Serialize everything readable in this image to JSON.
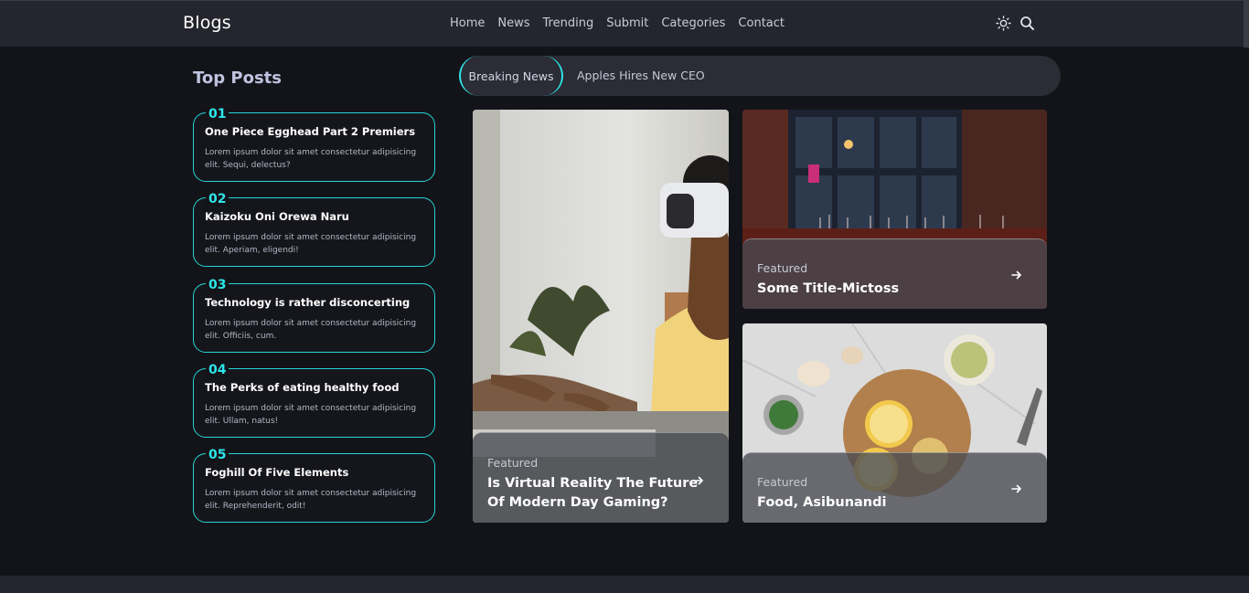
{
  "header": {
    "brand": "Blogs",
    "nav": [
      "Home",
      "News",
      "Trending",
      "Submit",
      "Categories",
      "Contact"
    ],
    "icons": [
      "sun-icon",
      "search-icon"
    ]
  },
  "top_posts": {
    "title": "Top Posts",
    "items": [
      {
        "num": "01",
        "title": "One Piece Egghead Part 2 Premiers",
        "desc": "Lorem ipsum dolor sit amet consectetur adipisicing elit. Sequi, delectus?"
      },
      {
        "num": "02",
        "title": "Kaizoku Oni Orewa Naru",
        "desc": "Lorem ipsum dolor sit amet consectetur adipisicing elit. Aperiam, eligendi!"
      },
      {
        "num": "03",
        "title": "Technology is rather disconcerting",
        "desc": "Lorem ipsum dolor sit amet consectetur adipisicing elit. Officiis, cum."
      },
      {
        "num": "04",
        "title": "The Perks of eating healthy food",
        "desc": "Lorem ipsum dolor sit amet consectetur adipisicing elit. Ullam, natus!"
      },
      {
        "num": "05",
        "title": "Foghill Of Five Elements",
        "desc": "Lorem ipsum dolor sit amet consectetur adipisicing elit. Reprehenderit, odit!"
      }
    ]
  },
  "breaking": {
    "label": "Breaking News",
    "headline": "Apples Hires New CEO"
  },
  "featured": [
    {
      "kicker": "Featured",
      "title_line1": "Is Virtual Reality The Future",
      "title_line2": "Of Modern Day Gaming?"
    },
    {
      "kicker": "Featured",
      "title": "Some Title-Mictoss"
    },
    {
      "kicker": "Featured",
      "title": "Food, Asibunandi"
    }
  ],
  "colors": {
    "accent": "#2ee6ea",
    "background": "#131419",
    "header": "#24252e"
  }
}
